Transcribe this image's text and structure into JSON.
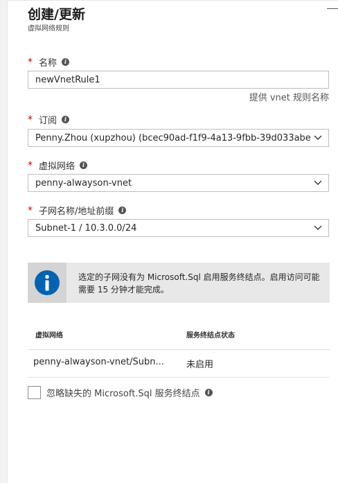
{
  "blade": {
    "title": "创建/更新",
    "subtitle": "虚拟网络规则"
  },
  "fields": {
    "name": {
      "label": "名称",
      "value": "newVnetRule1",
      "hint": "提供 vnet 规则名称"
    },
    "subscription": {
      "label": "订阅",
      "value": "Penny.Zhou (xupzhou) (bcec90ad-f1f9-4a13-9fbb-39d033abe"
    },
    "vnet": {
      "label": "虚拟网络",
      "value": "penny-alwayson-vnet"
    },
    "subnet": {
      "label": "子网名称/地址前缀",
      "value": "Subnet-1 / 10.3.0.0/24"
    }
  },
  "required_marker": "*",
  "info_glyph": "i",
  "info_banner": {
    "icon": "info-circle-icon",
    "text": "选定的子网没有为 Microsoft.Sql 启用服务终结点。启用访问可能需要 15 分钟才能完成。"
  },
  "table": {
    "headers": [
      "虚拟网络",
      "服务终结点状态"
    ],
    "rows": [
      {
        "vnet": "penny-alwayson-vnet/Subn...",
        "status": "未启用"
      }
    ]
  },
  "checkbox": {
    "label": "忽略缺失的 Microsoft.Sql 服务终结点",
    "checked": false
  },
  "colors": {
    "required": "#cc0000",
    "info_icon_bg": "#0063b1",
    "banner_bg": "#e8e8e8"
  }
}
